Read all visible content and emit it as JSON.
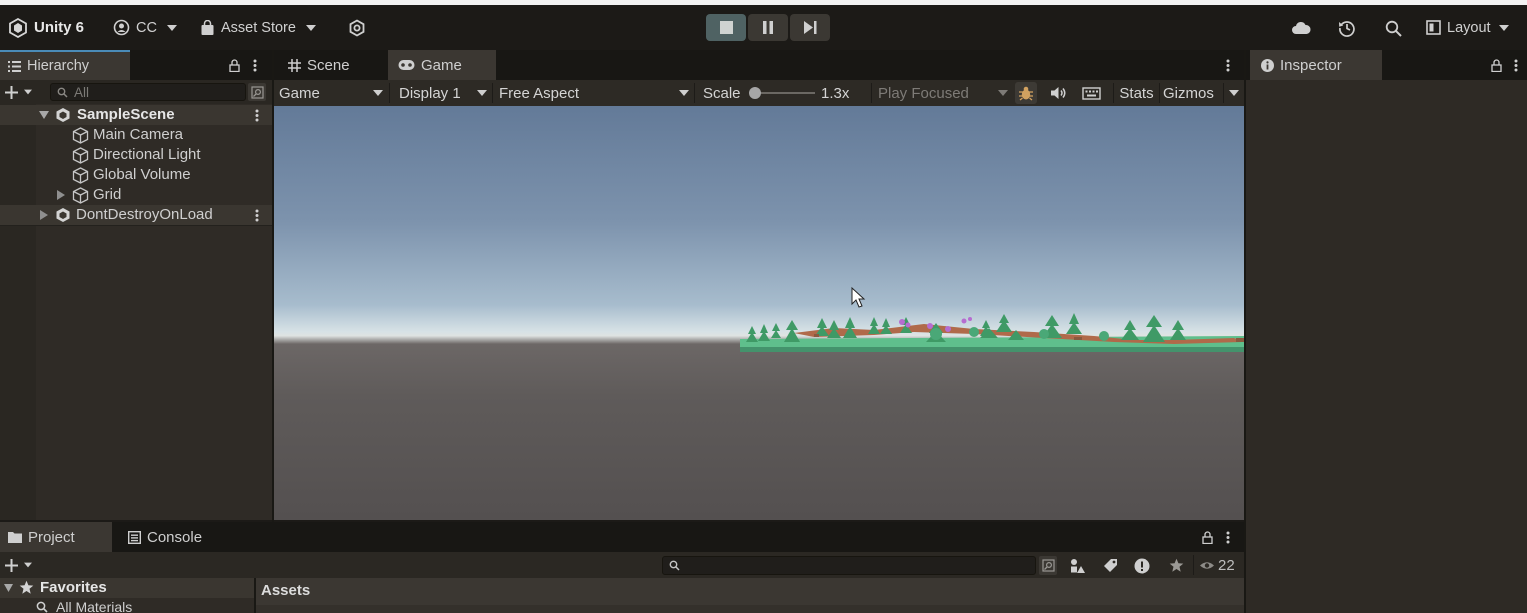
{
  "toolbar": {
    "product": "Unity 6",
    "account": "CC",
    "asset_store": "Asset Store",
    "layout": "Layout"
  },
  "hierarchy": {
    "tab": "Hierarchy",
    "search_placeholder": "All",
    "scene": "SampleScene",
    "items": [
      "Main Camera",
      "Directional Light",
      "Global Volume",
      "Grid"
    ],
    "dont_destroy": "DontDestroyOnLoad"
  },
  "center_tabs": {
    "scene": "Scene",
    "game": "Game"
  },
  "game_toolbar": {
    "mode": "Game",
    "display": "Display 1",
    "aspect": "Free Aspect",
    "scale_label": "Scale",
    "scale_value": "1.3x",
    "play_focused": "Play Focused",
    "stats": "Stats",
    "gizmos": "Gizmos"
  },
  "inspector": {
    "tab": "Inspector"
  },
  "project": {
    "tab_project": "Project",
    "tab_console": "Console",
    "visible_count": "22",
    "favorites": "Favorites",
    "all_materials": "All Materials",
    "assets": "Assets"
  },
  "colors": {
    "toolbar_bg": "#1c1a17",
    "panel_bg": "#34302b",
    "active_tab": "#3b3732",
    "play_active": "#4f6263",
    "ground_green": "#5fbf8c"
  }
}
